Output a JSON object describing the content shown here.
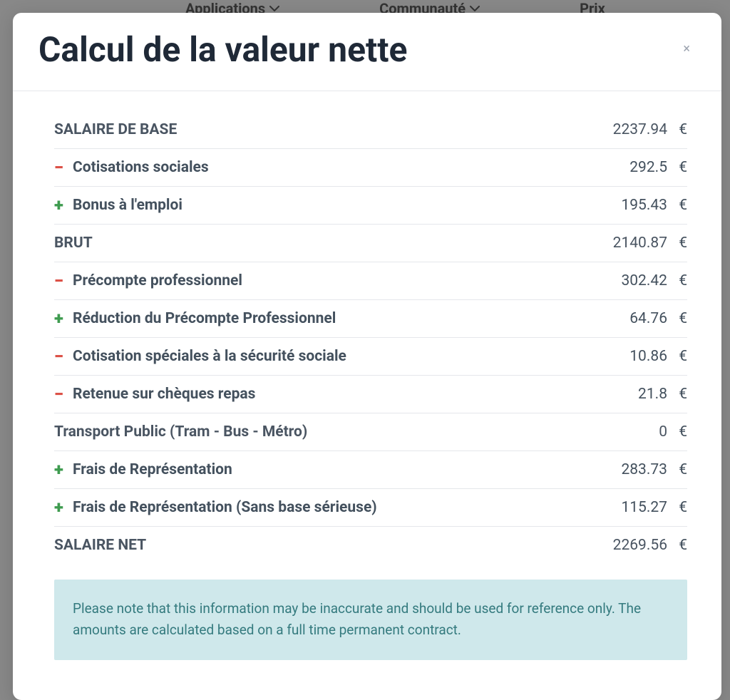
{
  "nav": {
    "applications": "Applications",
    "communaute": "Communauté",
    "prix": "Prix"
  },
  "modal": {
    "title": "Calcul de la valeur nette",
    "close": "×",
    "currency": "€",
    "items": [
      {
        "sign": "",
        "label": "SALAIRE DE BASE",
        "value": "2237.94",
        "total": true
      },
      {
        "sign": "minus",
        "label": "Cotisations sociales",
        "value": "292.5",
        "total": false
      },
      {
        "sign": "plus",
        "label": "Bonus à l'emploi",
        "value": "195.43",
        "total": false
      },
      {
        "sign": "",
        "label": "BRUT",
        "value": "2140.87",
        "total": true
      },
      {
        "sign": "minus",
        "label": "Précompte professionnel",
        "value": "302.42",
        "total": false
      },
      {
        "sign": "plus",
        "label": "Réduction du Précompte Professionnel",
        "value": "64.76",
        "total": false
      },
      {
        "sign": "minus",
        "label": "Cotisation spéciales à la sécurité sociale",
        "value": "10.86",
        "total": false
      },
      {
        "sign": "minus",
        "label": "Retenue sur chèques repas",
        "value": "21.8",
        "total": false
      },
      {
        "sign": "",
        "label": "Transport Public (Tram - Bus - Métro)",
        "value": "0",
        "total": true
      },
      {
        "sign": "plus",
        "label": "Frais de Représentation",
        "value": "283.73",
        "total": false
      },
      {
        "sign": "plus",
        "label": "Frais de Représentation (Sans base sérieuse)",
        "value": "115.27",
        "total": false
      },
      {
        "sign": "",
        "label": "SALAIRE NET",
        "value": "2269.56",
        "total": true,
        "noBorder": true
      }
    ],
    "infoBox": "Please note that this information may be inaccurate and should be used for reference only. The amounts are calculated based on a full time permanent contract."
  }
}
